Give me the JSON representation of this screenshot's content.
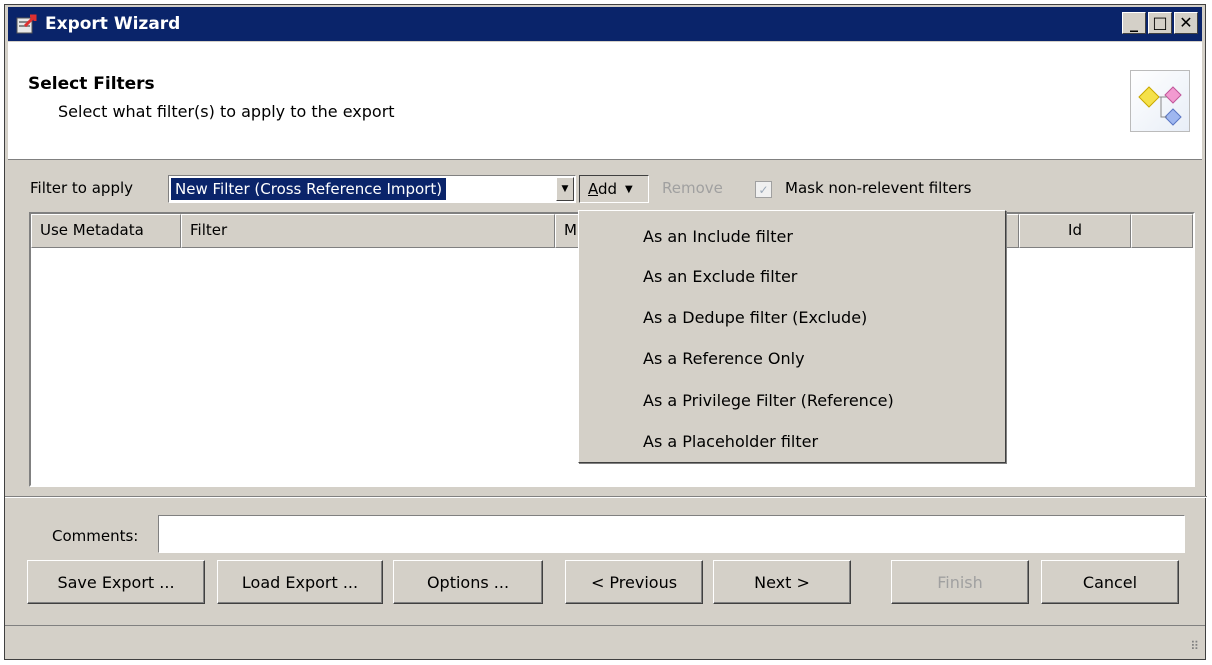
{
  "window": {
    "title": "Export Wizard",
    "controls": {
      "minimize": "_",
      "maximize": "□",
      "close": "✕"
    }
  },
  "header": {
    "title": "Select Filters",
    "subtitle": "Select what filter(s) to apply to the export",
    "icon": "filter-flow-icon"
  },
  "filter_bar": {
    "label": "Filter to apply",
    "selected_filter": "New Filter (Cross Reference Import)",
    "add_button": {
      "accel": "A",
      "rest": "dd",
      "arrow": "▼"
    },
    "remove_label": "Remove",
    "mask_checkbox": {
      "label": "Mask non-relevent filters",
      "checked": true
    }
  },
  "table": {
    "columns": [
      "Use Metadata",
      "Filter",
      "M",
      "Id"
    ],
    "rows": []
  },
  "add_menu": {
    "items": [
      "As an Include filter",
      "As an Exclude filter",
      "As a Dedupe filter (Exclude)",
      "As a Reference Only",
      "As a Privilege Filter (Reference)",
      "As a Placeholder filter"
    ]
  },
  "comments": {
    "label": "Comments:",
    "value": "",
    "placeholder": ""
  },
  "buttons": {
    "save_export": "Save Export ...",
    "load_export": "Load Export ...",
    "options": "Options ...",
    "previous": "< Previous",
    "next": "Next >",
    "finish": "Finish",
    "cancel": "Cancel"
  },
  "colors": {
    "title_bar": "#0a246a",
    "face": "#d4d0c8",
    "selection": "#0a246a",
    "disabled_text": "#a0a0a0"
  }
}
